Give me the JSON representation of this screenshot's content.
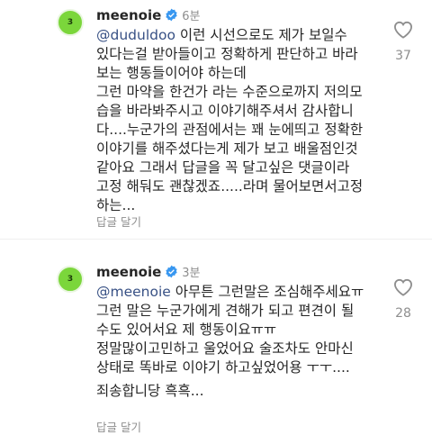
{
  "comments": [
    {
      "avatar_text": "3",
      "username": "meenoie",
      "time": "6분",
      "mention": "@duduldoo",
      "first_line": " 이런 시선으로도 제가 보일수",
      "lines1": [
        "있다는걸 받아들이고 정확하게 판단하고 바라",
        "보는 행동들이어야 하는데"
      ],
      "lines2": [
        "그런 마약을 한건가 라는 수준으로까지 저의모",
        "습을 바라봐주시고 이야기해주셔서 감사합니",
        "다....누군가의 관점에서는 꽤 눈에띄고 정확한",
        "이야기를 해주셨다는게 제가 보고 배울점인것",
        "같아요 그래서 답글을 꼭 달고싶은 댓글이라",
        "고정 해둬도 괜찮겠죠.....라며 물어보면서고정",
        "하는..."
      ],
      "reply_label": "답글 달기",
      "likes": "37"
    },
    {
      "avatar_text": "3",
      "username": "meenoie",
      "time": "3분",
      "mention": "@meenoie",
      "first_line": " 아무튼 그런말은 조심해주세요ㅠ",
      "lines1": [
        "그런 말은 누군가에게 견해가 되고 편견이 될",
        "수도 있어서요 제 행동이요ㅠㅠ"
      ],
      "lines2": [
        "정말많이고민하고 울었어요 술조차도 안마신",
        "상태로 똑바로 이야기 하고싶었어용 ㅜㅜ...."
      ],
      "lines3": [
        "죄송합니당 흑흑..."
      ],
      "reply_label": "답글 달기",
      "likes": "28"
    }
  ],
  "colors": {
    "mention": "#385185",
    "avatar": "#7bd63b",
    "verified": "#3897f0",
    "meta": "#8e8e8e"
  },
  "icons": [
    "verified-badge-icon",
    "heart-outline-icon"
  ]
}
